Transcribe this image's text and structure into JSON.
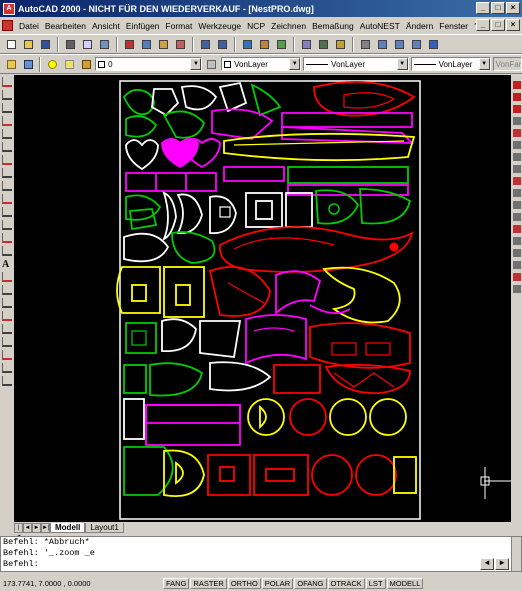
{
  "window": {
    "title": "AutoCAD 2000 - NICHT FÜR DEN WIEDERVERKAUF - [NestPRO.dwg]",
    "controls": [
      "_",
      "□",
      "×"
    ]
  },
  "menubar": {
    "items": [
      "Datei",
      "Bearbeiten",
      "Ansicht",
      "Einfügen",
      "Format",
      "Werkzeuge",
      "NCP",
      "Zeichnen",
      "Bemaßung",
      "AutoNEST",
      "Ändern",
      "Fenster",
      "?"
    ],
    "doc_controls": [
      "_",
      "□",
      "×"
    ]
  },
  "toolbar_standard": {
    "icons": [
      "new-icon",
      "open-icon",
      "save-icon",
      "print-icon",
      "preview-icon",
      "find-icon",
      "cut-icon",
      "copy-icon",
      "paste-icon",
      "match-icon",
      "undo-icon",
      "redo-icon",
      "hyperlink-icon",
      "snap-icon",
      "ucs-icon",
      "distance-icon",
      "properties-icon",
      "designcenter-icon",
      "pan-icon",
      "zoom-realtime-icon",
      "zoom-window-icon",
      "zoom-previous-icon",
      "help-icon"
    ]
  },
  "toolbar_layers": {
    "layer_value": "0",
    "color_value": "VonLayer",
    "linetype_value": "VonLayer",
    "lineweight_value": "VonLayer",
    "plotstyle_value": "VonFarbe"
  },
  "left_tools": [
    "line-icon",
    "xline-icon",
    "pline-icon",
    "polygon-icon",
    "rectangle-icon",
    "arc-icon",
    "circle-icon",
    "spline-icon",
    "ellipse-icon",
    "block-icon",
    "insert-icon",
    "point-icon",
    "hatch-icon",
    "region-icon",
    "text-icon",
    "layer-icon",
    "tool-icon",
    "tool-icon",
    "tool-icon",
    "tool-icon",
    "tool-icon",
    "tool-icon",
    "tool-icon",
    "tool-icon"
  ],
  "right_tools": [
    "nc-icon",
    "nc-icon",
    "help-icon",
    "erase-icon",
    "copy-icon",
    "mirror-icon",
    "offset-icon",
    "array-icon",
    "move-icon",
    "rotate-icon",
    "scale-icon",
    "stretch-icon",
    "trim-icon",
    "extend-icon",
    "break-icon",
    "chamfer-icon",
    "fillet-icon",
    "explode-icon"
  ],
  "colors": {
    "canvas": "#000000",
    "sheet_border": "#ffffff",
    "yellow": "#ffff00",
    "green": "#00cc00",
    "magenta": "#ff00ff",
    "red": "#ff0000",
    "white": "#ffffff",
    "cyan": "#00ffff"
  },
  "tabs": {
    "nav": [
      "|◄",
      "◄",
      "►",
      "►|"
    ],
    "items": [
      "Modell",
      "Layout1"
    ],
    "active": "Modell"
  },
  "command": {
    "lines": [
      "Befehl: *Abbruch*",
      "Befehl: '_.zoom _e",
      "Befehl:"
    ]
  },
  "status": {
    "coords": "173.7741, 7.0000 , 0.0000",
    "buttons": [
      "FANG",
      "RASTER",
      "ORTHO",
      "POLAR",
      "OFANG",
      "OTRACK",
      "LST",
      "MODELL"
    ]
  }
}
